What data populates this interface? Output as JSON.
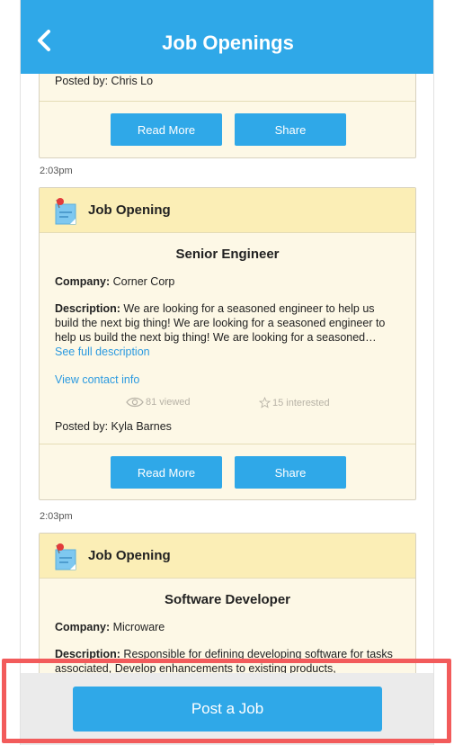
{
  "header": {
    "title": "Job Openings",
    "back_icon": "chevron-left-icon"
  },
  "cards": [
    {
      "posted_by": "Posted by: Chris Lo",
      "read_more": "Read More",
      "share": "Share"
    },
    {
      "timestamp": "2:03pm",
      "header_label": "Job Opening",
      "job_title": "Senior Engineer",
      "company_label": "Company:",
      "company": "Corner Corp",
      "description_label": "Description:",
      "description": "We are looking for a seasoned engineer to help us build the next big thing! We are looking for a seasoned engineer to help us build the next big thing! We are looking for a seasoned…",
      "see_full": "See full description",
      "contact": "View contact info",
      "viewed": "81 viewed",
      "interested": "15 interested",
      "posted_by": "Posted by: Kyla Barnes",
      "read_more": "Read More",
      "share": "Share"
    },
    {
      "timestamp": "2:03pm",
      "header_label": "Job Opening",
      "job_title": "Software Developer",
      "company_label": "Company:",
      "company": "Microware",
      "description_label": "Description:",
      "description": "Responsible for defining developing software for tasks associated, Develop enhancements to existing products,"
    }
  ],
  "footer": {
    "post_button": "Post a Job"
  },
  "colors": {
    "accent": "#2fa8e8",
    "card_bg": "#fdf8e6",
    "card_header": "#fbeeb6",
    "link": "#2b9ae0",
    "highlight": "#f25b5b"
  }
}
